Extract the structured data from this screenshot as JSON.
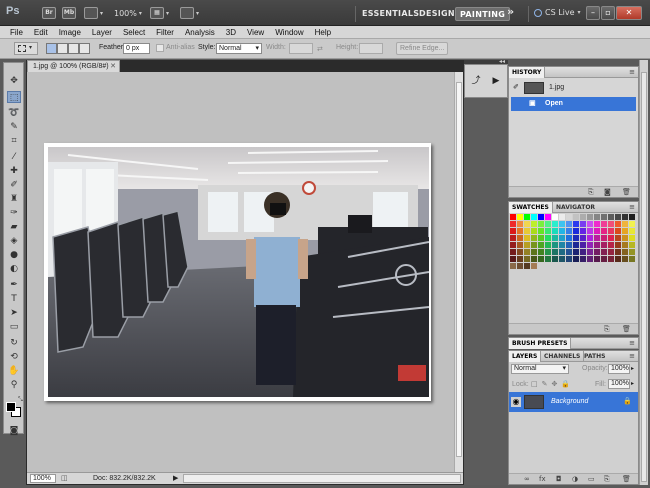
{
  "app": {
    "logo": "Ps",
    "bridge_label": "Br",
    "minibridge_label": "Mb",
    "zoom": "100%",
    "workspaces": [
      "ESSENTIALS",
      "DESIGN",
      "PAINTING"
    ],
    "active_workspace": "PAINTING",
    "more": "»",
    "cs_live": "CS Live"
  },
  "menu": [
    "File",
    "Edit",
    "Image",
    "Layer",
    "Select",
    "Filter",
    "Analysis",
    "3D",
    "View",
    "Window",
    "Help"
  ],
  "options": {
    "feather_label": "Feather:",
    "feather_value": "0 px",
    "antialias_label": "Anti-alias",
    "style_label": "Style:",
    "style_value": "Normal",
    "width_label": "Width:",
    "height_label": "Height:",
    "refine_label": "Refine Edge..."
  },
  "document": {
    "tab_title": "1.jpg @ 100% (RGB/8#)",
    "status_zoom": "100%",
    "status_doc": "Doc: 832.2K/832.2K"
  },
  "history": {
    "title": "HISTORY",
    "snapshot": "1.jpg",
    "items": [
      "Open"
    ]
  },
  "swatches": {
    "tabs": [
      "SWATCHES",
      "NAVIGATOR"
    ]
  },
  "brush_presets": {
    "title": "BRUSH PRESETS"
  },
  "layers": {
    "tabs": [
      "LAYERS",
      "CHANNELS",
      "PATHS"
    ],
    "blend_mode": "Normal",
    "opacity_label": "Opacity:",
    "opacity_value": "100%",
    "lock_label": "Lock:",
    "fill_label": "Fill:",
    "fill_value": "100%",
    "items": [
      "Background"
    ]
  },
  "colors": {
    "selection_blue": "#3875d7",
    "active_workspace_bg": "#6d6d6d"
  }
}
